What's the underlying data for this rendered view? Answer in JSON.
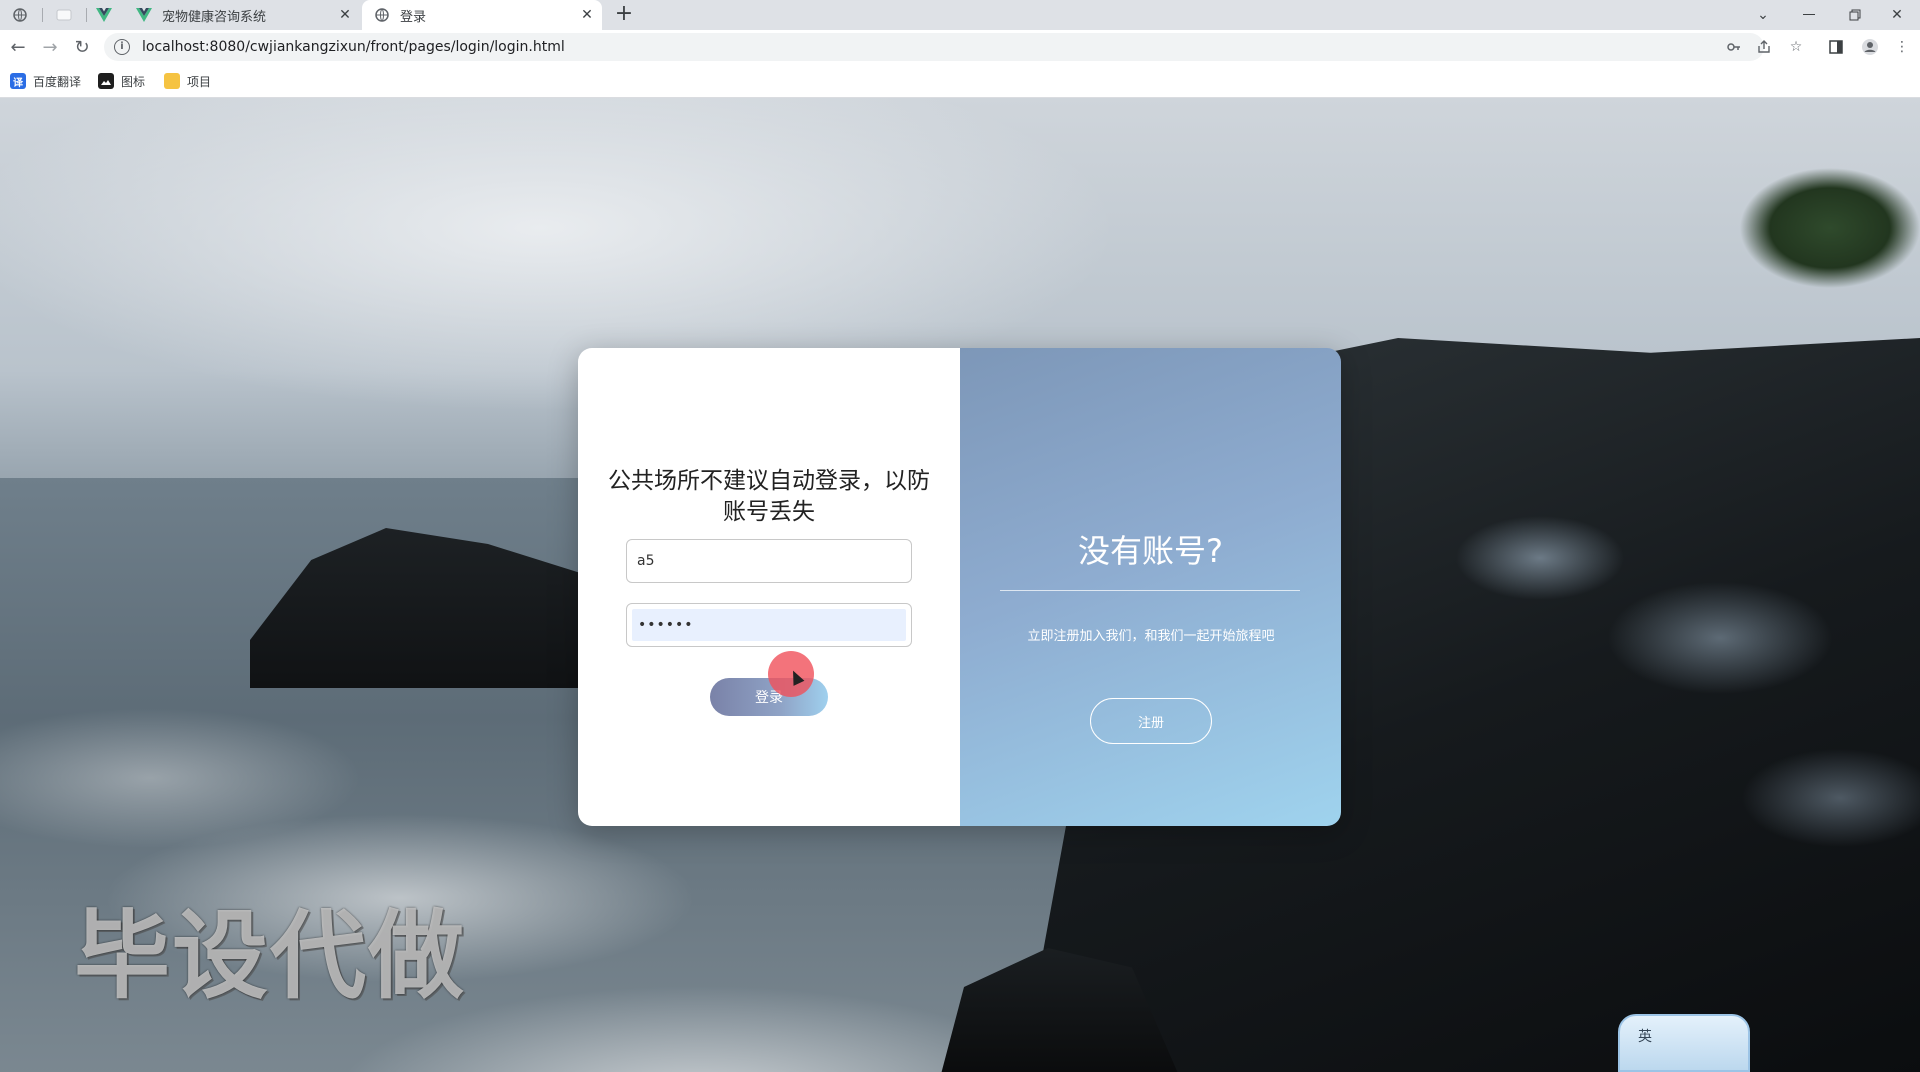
{
  "browser": {
    "tabs": [
      {
        "title": "宠物健康咨询系统",
        "active": false
      },
      {
        "title": "登录",
        "active": true
      }
    ],
    "new_tab": "+",
    "address": "localhost:8080/cwjiankangzixun/front/pages/login/login.html",
    "bookmarks": [
      {
        "label": "百度翻译",
        "icon": "translate-icon",
        "color": "#2b6de5"
      },
      {
        "label": "图标",
        "icon": "image-icon",
        "color": "#1f1f1f"
      },
      {
        "label": "项目",
        "icon": "folder-icon",
        "color": "#f5c342"
      }
    ]
  },
  "login": {
    "notice": "公共场所不建议自动登录，以防账号丢失",
    "username_value": "a5",
    "password_value": "••••••",
    "login_label": "登录"
  },
  "register_panel": {
    "heading": "没有账号?",
    "text": "立即注册加入我们，和我们一起开始旅程吧",
    "register_label": "注册"
  },
  "watermark": "毕设代做",
  "ime": {
    "lang": "英"
  },
  "colors": {
    "panel_gradient_start": "#7d97b8",
    "panel_gradient_end": "#9fd3ee",
    "autofill_bg": "#e8f0fe"
  }
}
